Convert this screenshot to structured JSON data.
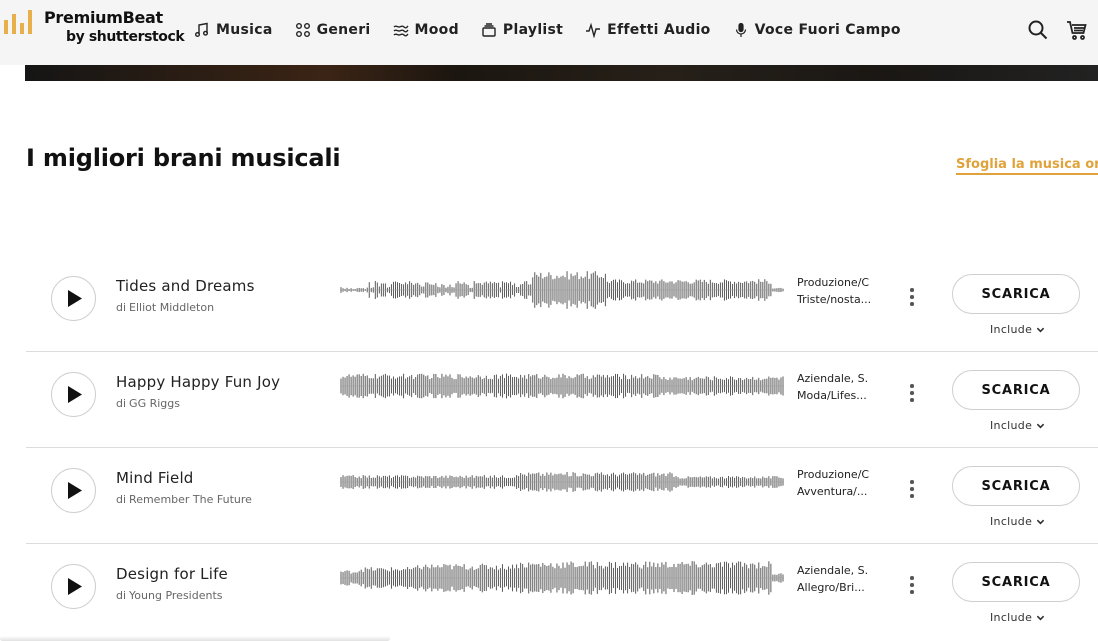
{
  "logo": {
    "title": "PremiumBeat",
    "subtitle": "by shutterstock",
    "accent": "#e8b04b"
  },
  "nav": [
    {
      "label": "Musica",
      "icon": "music-note-icon"
    },
    {
      "label": "Generi",
      "icon": "grid-dots-icon"
    },
    {
      "label": "Mood",
      "icon": "waves-icon"
    },
    {
      "label": "Playlist",
      "icon": "playlist-icon"
    },
    {
      "label": "Effetti Audio",
      "icon": "pulse-icon"
    },
    {
      "label": "Voce Fuori Campo",
      "icon": "microphone-icon"
    }
  ],
  "header_actions": {
    "search_icon": "search-icon",
    "cart_icon": "cart-icon"
  },
  "main": {
    "title": "I migliori brani musicali",
    "browse_link": "Sfoglia la musica ora"
  },
  "tracks": [
    {
      "name": "Tides and Dreams",
      "by": "di",
      "artist": "Elliot Middleton",
      "tags": [
        "Produzione/C",
        "Triste/nosta..."
      ],
      "download": "SCARICA",
      "include": "Include"
    },
    {
      "name": "Happy Happy Fun Joy",
      "by": "di",
      "artist": "GG Riggs",
      "tags": [
        "Aziendale,  S.",
        "Moda/Lifes..."
      ],
      "download": "SCARICA",
      "include": "Include"
    },
    {
      "name": "Mind Field",
      "by": "di",
      "artist": "Remember The Future",
      "tags": [
        "Produzione/C",
        "Avventura/..."
      ],
      "download": "SCARICA",
      "include": "Include"
    },
    {
      "name": "Design for Life",
      "by": "di",
      "artist": "Young Presidents",
      "tags": [
        "Aziendale,  S.",
        "Allegro/Bri..."
      ],
      "download": "SCARICA",
      "include": "Include"
    }
  ],
  "colors": {
    "accent": "#e0a33b",
    "text": "#111111",
    "muted": "#666666"
  }
}
